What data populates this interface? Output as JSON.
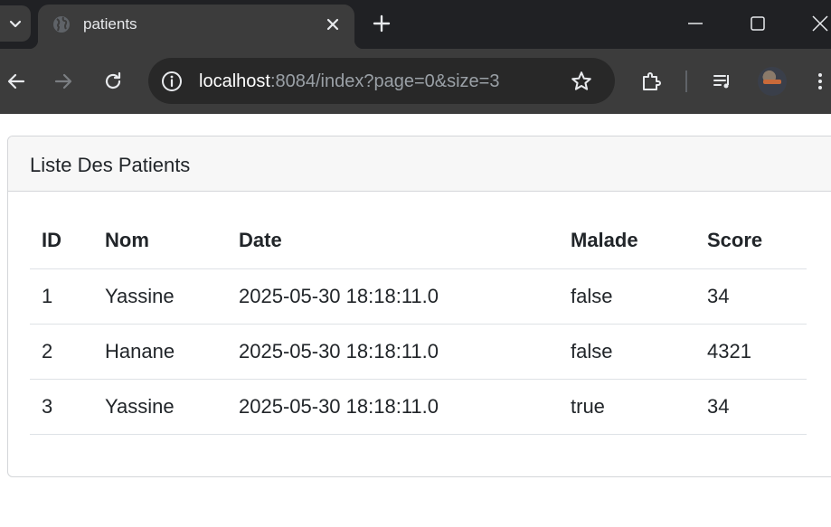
{
  "browser": {
    "tab": {
      "title": "patients",
      "favicon": "globe-icon"
    },
    "address": {
      "host": "localhost",
      "rest": ":8084/index?page=0&size=3"
    },
    "icons": [
      "chevron-down-icon",
      "close-icon",
      "plus-icon",
      "minimize-icon",
      "maximize-icon",
      "window-close-icon",
      "back-arrow-icon",
      "forward-arrow-icon",
      "reload-icon",
      "info-icon",
      "star-icon",
      "extensions-icon",
      "media-queue-icon",
      "avatar",
      "more-vert-icon"
    ]
  },
  "page": {
    "card_title": "Liste Des Patients",
    "table": {
      "headers": [
        "ID",
        "Nom",
        "Date",
        "Malade",
        "Score"
      ],
      "rows": [
        [
          "1",
          "Yassine",
          "2025-05-30 18:18:11.0",
          "false",
          "34"
        ],
        [
          "2",
          "Hanane",
          "2025-05-30 18:18:11.0",
          "false",
          "4321"
        ],
        [
          "3",
          "Yassine",
          "2025-05-30 18:18:11.0",
          "true",
          "34"
        ]
      ]
    }
  },
  "colors": {
    "chrome_dark": "#202124",
    "chrome_toolbar": "#3c3c3c",
    "omnibox": "#282828",
    "card_header_bg": "#f7f7f7",
    "text": "#212529",
    "border": "#dee2e6"
  }
}
